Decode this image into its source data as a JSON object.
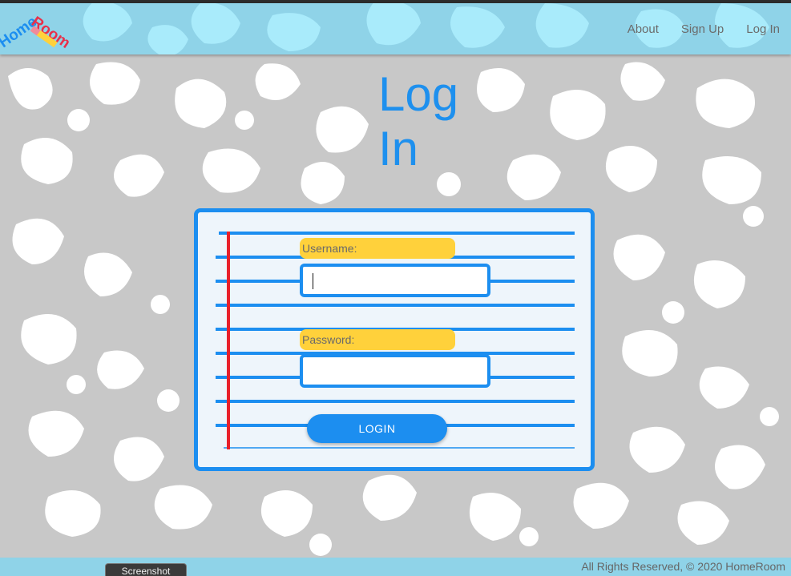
{
  "brand": {
    "logo_word_1": "Home",
    "logo_word_2": "Room"
  },
  "nav": {
    "about": "About",
    "signup": "Sign Up",
    "login": "Log In"
  },
  "page": {
    "title_line_1": "Log",
    "title_line_2": "In"
  },
  "form": {
    "username_label": "Username:",
    "username_value": "",
    "password_label": "Password:",
    "password_value": "",
    "submit_label": "LOGIN"
  },
  "footer": {
    "copyright": "All Rights Reserved, © 2020 HomeRoom"
  },
  "taskbar": {
    "screenshot_label": "Screenshot"
  },
  "colors": {
    "accent_blue": "#1c8ef0",
    "header_blue": "#8fd3e8",
    "label_yellow": "#ffd13b",
    "margin_red": "#e8202a",
    "background_gray": "#c8c8c8"
  }
}
